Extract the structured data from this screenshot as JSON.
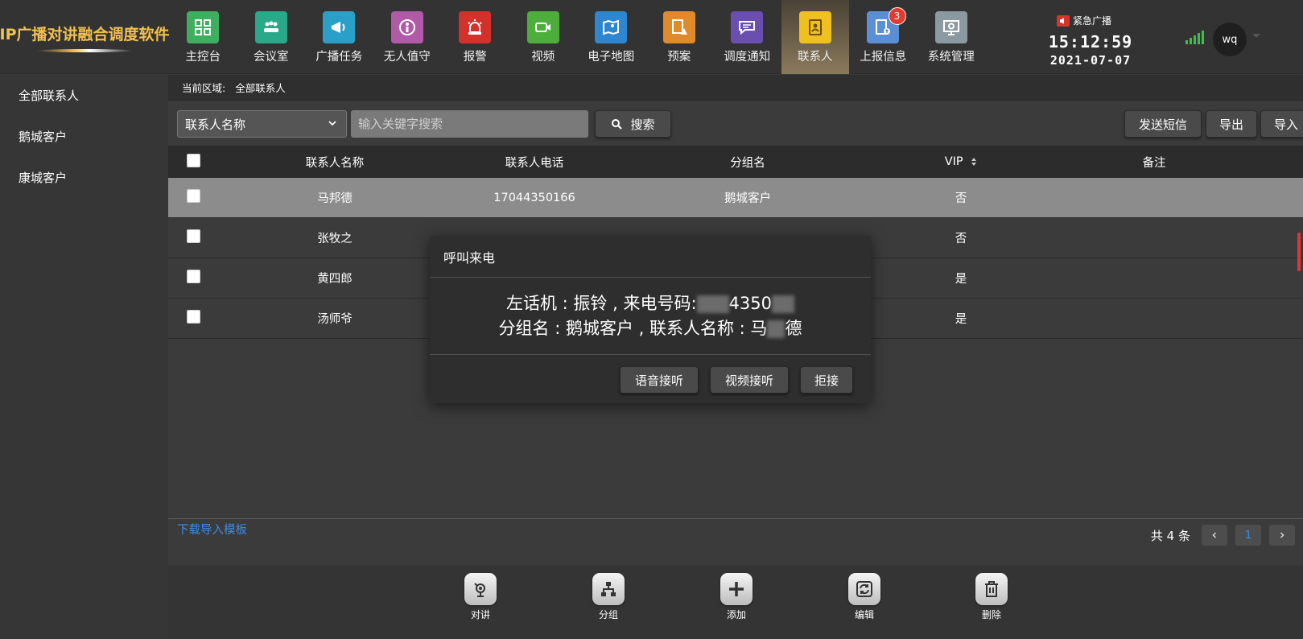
{
  "app": {
    "logo_text": "IP广播对讲融合调度软件"
  },
  "nav": [
    {
      "label": "主控台",
      "icon": "dashboard-icon",
      "color": "#3fae5f"
    },
    {
      "label": "会议室",
      "icon": "meeting-icon",
      "color": "#2aa88a"
    },
    {
      "label": "广播任务",
      "icon": "broadcast-icon",
      "color": "#2aa0c8"
    },
    {
      "label": "无人值守",
      "icon": "unattended-icon",
      "color": "#b05aa8"
    },
    {
      "label": "报警",
      "icon": "alarm-icon",
      "color": "#d3312c"
    },
    {
      "label": "视频",
      "icon": "video-icon",
      "color": "#4eae3b"
    },
    {
      "label": "电子地图",
      "icon": "map-icon",
      "color": "#2f86d0"
    },
    {
      "label": "预案",
      "icon": "plan-icon",
      "color": "#e08a2a"
    },
    {
      "label": "调度通知",
      "icon": "notice-icon",
      "color": "#6a4fb0"
    },
    {
      "label": "联系人",
      "icon": "contacts-icon",
      "color": "#f0c020",
      "active": true
    },
    {
      "label": "上报信息",
      "icon": "report-icon",
      "color": "#5a8fd6",
      "badge": "3"
    },
    {
      "label": "系统管理",
      "icon": "settings-icon",
      "color": "#8a9aa0"
    }
  ],
  "header": {
    "emergency_label": "紧急广播",
    "time": "15:12:59",
    "date": "2021-07-07",
    "user": "wq"
  },
  "sidebar": {
    "items": [
      {
        "label": "全部联系人"
      },
      {
        "label": "鹅城客户"
      },
      {
        "label": "康城客户"
      }
    ]
  },
  "breadcrumb": {
    "prefix": "当前区域:",
    "current": "全部联系人"
  },
  "toolbar": {
    "filter_value": "联系人名称",
    "search_placeholder": "输入关键字搜索",
    "search_label": "搜索",
    "sms_label": "发送短信",
    "export_label": "导出",
    "import_label": "导入"
  },
  "table": {
    "columns": [
      "联系人名称",
      "联系人电话",
      "分组名",
      "VIP",
      "备注"
    ],
    "rows": [
      {
        "name": "马邦德",
        "phone": "17044350166",
        "group": "鹅城客户",
        "vip": "否",
        "note": ""
      },
      {
        "name": "张牧之",
        "phone": "",
        "group": "",
        "vip": "否",
        "note": ""
      },
      {
        "name": "黄四郎",
        "phone": "",
        "group": "",
        "vip": "是",
        "note": ""
      },
      {
        "name": "汤师爷",
        "phone": "",
        "group": "",
        "vip": "是",
        "note": ""
      }
    ]
  },
  "footer": {
    "download_template": "下载导入模板",
    "total": "共 4 条",
    "current_page": "1"
  },
  "tools": [
    {
      "label": "对讲",
      "icon": "intercom-icon"
    },
    {
      "label": "分组",
      "icon": "group-tree-icon"
    },
    {
      "label": "添加",
      "icon": "plus-icon"
    },
    {
      "label": "编辑",
      "icon": "refresh-edit-icon"
    },
    {
      "label": "删除",
      "icon": "trash-icon"
    }
  ],
  "dialog": {
    "title": "呼叫来电",
    "line1_prefix": "左话机 : 振铃 , 来电号码:",
    "line1_visible": "4350",
    "line2_prefix": "分组名 : 鹅城客户 , 联系人名称 : 马",
    "line2_suffix": "德",
    "voice_answer": "语音接听",
    "video_answer": "视频接听",
    "reject": "拒接"
  },
  "colors": {
    "accent_link": "#3d8ee8",
    "badge": "#e03b2f",
    "selected_row": "#8c8c8c"
  }
}
